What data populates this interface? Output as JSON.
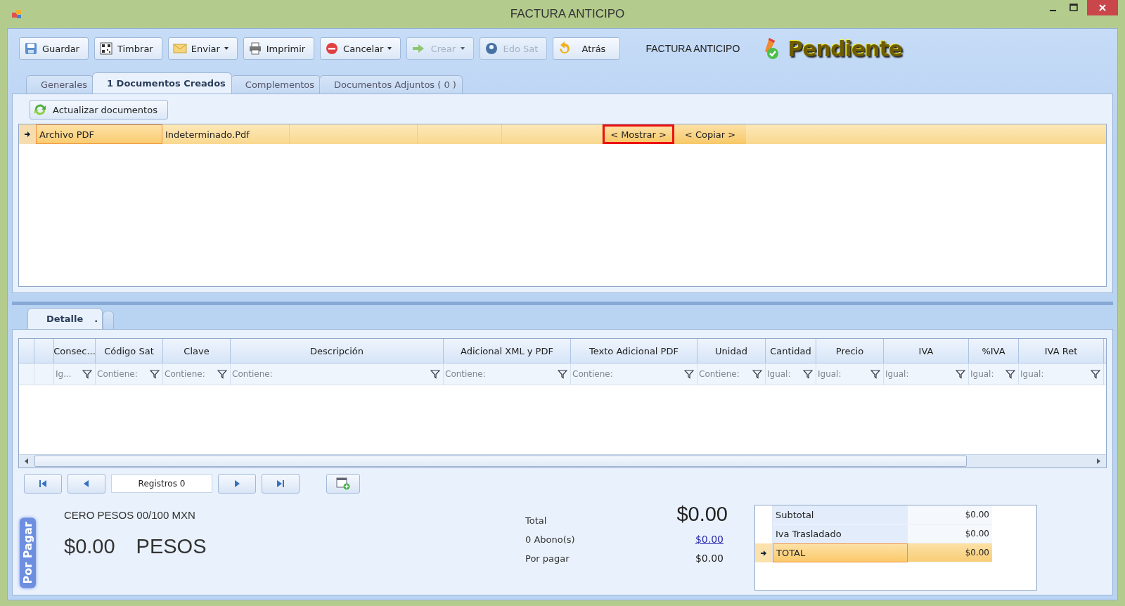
{
  "window": {
    "title": "FACTURA ANTICIPO"
  },
  "toolbar": {
    "buttons": [
      {
        "label": "Guardar",
        "kind": "plain",
        "disabled": false
      },
      {
        "label": "Timbrar",
        "kind": "plain",
        "disabled": false
      },
      {
        "label": "Enviar",
        "kind": "split",
        "disabled": false
      },
      {
        "label": "Imprimir",
        "kind": "plain",
        "disabled": false
      },
      {
        "label": "Cancelar",
        "kind": "split",
        "disabled": false
      },
      {
        "label": "Crear",
        "kind": "split",
        "disabled": true
      },
      {
        "label": "Edo Sat",
        "kind": "plain",
        "disabled": true
      },
      {
        "label": "Atrás",
        "kind": "plain",
        "disabled": false
      }
    ],
    "document_type": "FACTURA ANTICIPO",
    "status": "Pendiente"
  },
  "tabs": [
    {
      "label": "Generales",
      "selected": false
    },
    {
      "label": "1 Documentos Creados",
      "selected": true
    },
    {
      "label": "Complementos",
      "selected": false
    },
    {
      "label": "Documentos Adjuntos ( 0 )",
      "selected": false
    }
  ],
  "documents": {
    "refresh_button": "Actualizar documentos",
    "rows": [
      {
        "selected": true,
        "cells": [
          "Archivo PDF",
          "Indeterminado.Pdf"
        ],
        "actions": [
          {
            "label": "< Mostrar >",
            "highlighted": true
          },
          {
            "label": "< Copiar >",
            "highlighted": false
          }
        ]
      }
    ]
  },
  "detail_tabs": [
    {
      "label": "Detalle",
      "mark": ".",
      "selected": true
    },
    {
      "selected": false
    }
  ],
  "detail_grid": {
    "columns": [
      {
        "label": "Consec...",
        "filter": "Ig..."
      },
      {
        "label": "Código Sat",
        "filter": "Contiene:"
      },
      {
        "label": "Clave",
        "filter": "Contiene:"
      },
      {
        "label": "Descripción",
        "filter": "Contiene:"
      },
      {
        "label": "Adicional XML y PDF",
        "filter": "Contiene:"
      },
      {
        "label": "Texto Adicional PDF",
        "filter": "Contiene:"
      },
      {
        "label": "Unidad",
        "filter": "Contiene:"
      },
      {
        "label": "Cantidad",
        "filter": "Igual:"
      },
      {
        "label": "Precio",
        "filter": "Igual:"
      },
      {
        "label": "IVA",
        "filter": "Igual:"
      },
      {
        "label": "%IVA",
        "filter": "Igual:"
      },
      {
        "label": "IVA Ret",
        "filter": "Igual:"
      }
    ]
  },
  "navigator": {
    "records": "Registros  0"
  },
  "por_pagar": {
    "tab": "Por Pagar",
    "amount_words": "CERO PESOS 00/100 MXN",
    "amount": "$0.00",
    "currency": "PESOS"
  },
  "summary": [
    {
      "label": "Total",
      "value": "$0.00",
      "kind": "big"
    },
    {
      "label": "0 Abono(s)",
      "value": "$0.00",
      "kind": "link"
    },
    {
      "label": "Por pagar",
      "value": "$0.00",
      "kind": "plain"
    }
  ],
  "totals": [
    {
      "label": "Subtotal",
      "value": "$0.00",
      "selected": false
    },
    {
      "label": "Iva Trasladado",
      "value": "$0.00",
      "selected": false
    },
    {
      "label": "TOTAL",
      "value": "$0.00",
      "selected": true
    }
  ]
}
